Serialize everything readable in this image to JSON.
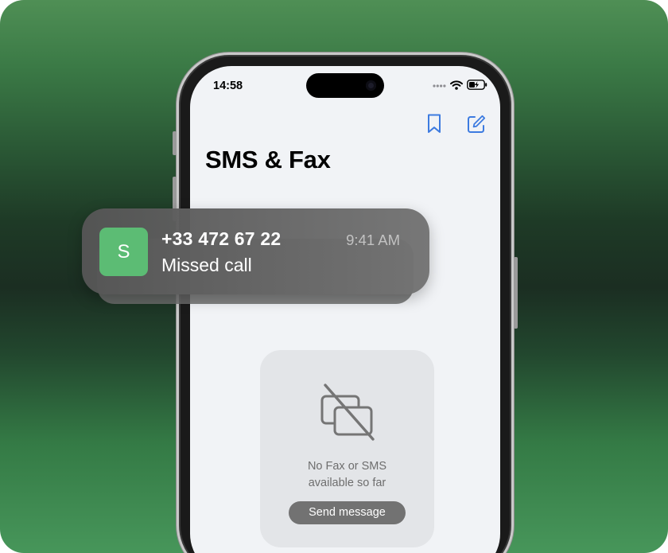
{
  "status_bar": {
    "time": "14:58"
  },
  "header": {
    "title": "SMS & Fax",
    "actions": [
      {
        "name": "bookmark-icon"
      },
      {
        "name": "compose-icon"
      }
    ]
  },
  "empty_state": {
    "icon": "no-messages-icon",
    "line1": "No Fax or SMS",
    "line2": "available so far",
    "button_label": "Send message"
  },
  "notification": {
    "avatar_letter": "S",
    "title": "+33 472 67 22",
    "time": "9:41 AM",
    "body": "Missed call"
  },
  "colors": {
    "accent": "#3d7be0",
    "avatar": "#5cbc74",
    "background_top": "#4f8f55",
    "background_mid": "#1b2e22"
  }
}
